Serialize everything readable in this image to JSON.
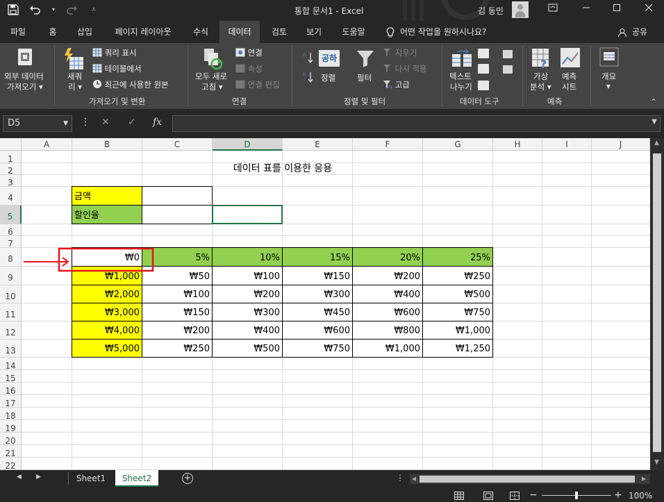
{
  "titlebar": {
    "doc_title": "통합 문서1  -  Excel",
    "user_name": "김 동민",
    "qat_icons": [
      "save-icon",
      "undo-icon",
      "redo-icon",
      "customize-qat-icon"
    ],
    "window_icons": [
      "ribbon-display-icon",
      "minimize-icon",
      "maximize-icon",
      "close-icon"
    ]
  },
  "tabs": [
    "파일",
    "홈",
    "삽입",
    "페이지 레이아웃",
    "수식",
    "데이터",
    "검토",
    "보기",
    "도움말"
  ],
  "active_tab": "데이터",
  "tell_me": "어떤 작업을 원하시나요?",
  "share": "공유",
  "ribbon": {
    "get_external": [
      "외부 데이터",
      "가져오기"
    ],
    "new_query": [
      "새쿼",
      "리"
    ],
    "show_queries": "쿼리 표시",
    "from_table": "테이블에서",
    "recent_sources": "최근에 사용한 원본",
    "group_get_transform": "가져오기 및 변환",
    "refresh_all": [
      "모두 새로",
      "고침"
    ],
    "connections": "연결",
    "properties": "속성",
    "edit_links": "연결 편집",
    "group_connections": "연결",
    "sort_label": "정렬",
    "sort_big_icon_text": "공하",
    "filter": "필터",
    "clear": "지우기",
    "reapply": "다시 적용",
    "advanced": "고급",
    "group_sort_filter": "정렬 및 필터",
    "text_to_columns": [
      "텍스트",
      "나누기"
    ],
    "group_data_tools": "데이터 도구",
    "what_if": [
      "가상",
      "분석"
    ],
    "forecast_sheet": [
      "예측",
      "시트"
    ],
    "group_forecast": "예측",
    "outline": "개요"
  },
  "formula_bar": {
    "name_box": "D5",
    "cancel": "✕",
    "enter": "✓",
    "fx": "fx",
    "formula": ""
  },
  "columns": [
    "A",
    "B",
    "C",
    "D",
    "E",
    "F",
    "G",
    "H",
    "I",
    "J"
  ],
  "selected_column": "D",
  "rows": [
    "1",
    "2",
    "3",
    "4",
    "5",
    "6",
    "7",
    "8",
    "9",
    "10",
    "11",
    "12",
    "13",
    "14",
    "15",
    "16",
    "17",
    "18",
    "19",
    "20",
    "21",
    "22"
  ],
  "selected_row": "5",
  "sheet": {
    "title": "데이터 표를 이용한 응용",
    "amount_label": "금액",
    "amount_value": "",
    "rate_label": "할인율",
    "rate_value": "",
    "d5": "",
    "table_corner": "₩0",
    "rates": [
      "5%",
      "10%",
      "15%",
      "20%",
      "25%"
    ],
    "amounts": [
      "₩1,000",
      "₩2,000",
      "₩3,000",
      "₩4,000",
      "₩5,000"
    ],
    "values": [
      [
        "₩50",
        "₩100",
        "₩150",
        "₩200",
        "₩250"
      ],
      [
        "₩100",
        "₩200",
        "₩300",
        "₩400",
        "₩500"
      ],
      [
        "₩150",
        "₩300",
        "₩450",
        "₩600",
        "₩750"
      ],
      [
        "₩200",
        "₩400",
        "₩600",
        "₩800",
        "₩1,000"
      ],
      [
        "₩250",
        "₩500",
        "₩750",
        "₩1,000",
        "₩1,250"
      ]
    ]
  },
  "sheets": [
    "Sheet1",
    "Sheet2"
  ],
  "active_sheet": "Sheet2",
  "status": {
    "zoom": "100%",
    "views": [
      "normal-view-icon",
      "page-layout-view-icon",
      "page-break-view-icon"
    ]
  },
  "colors": {
    "yellow": "#ffff00",
    "green": "#92d050",
    "selection": "#217346",
    "annotation": "#e8141b"
  }
}
